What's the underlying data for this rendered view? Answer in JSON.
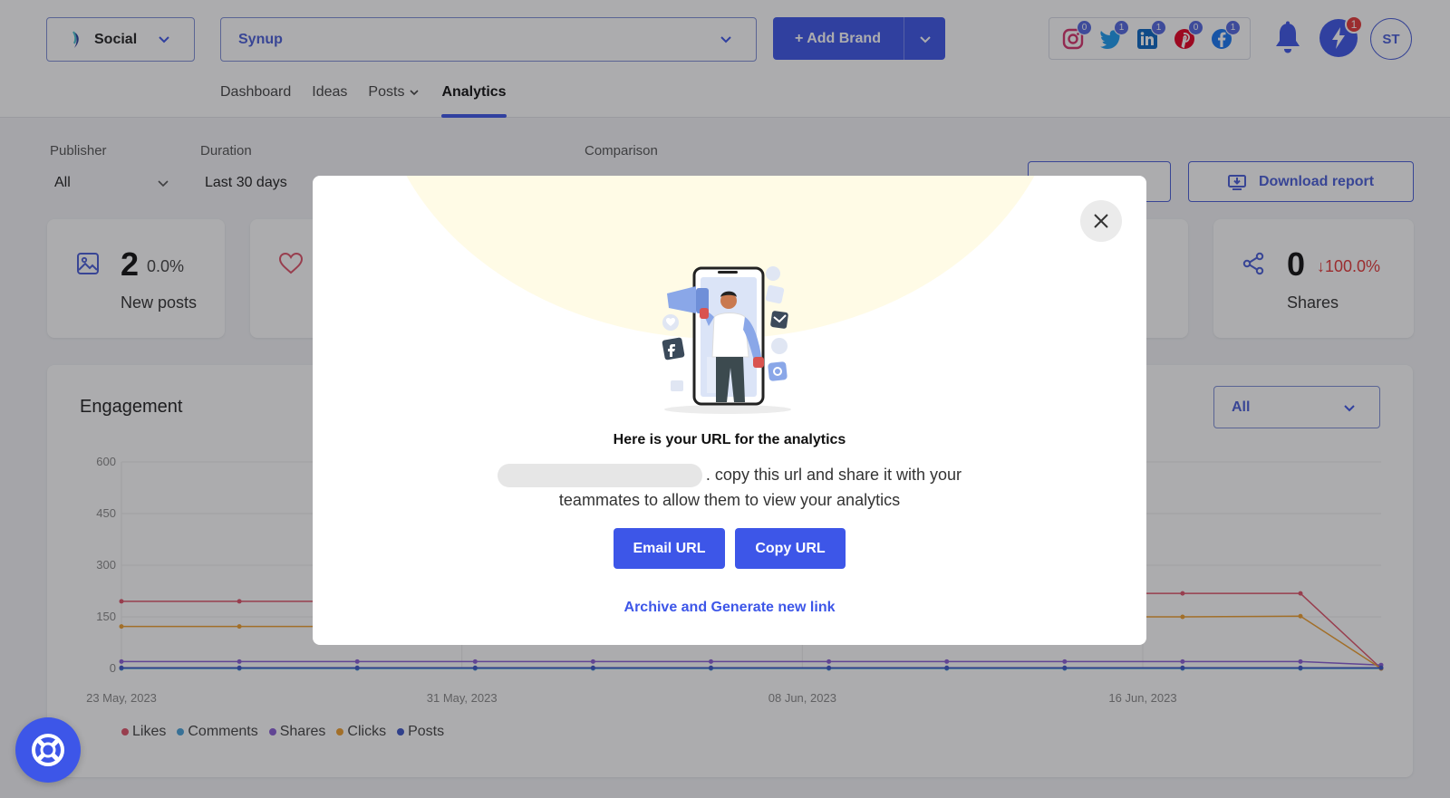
{
  "header": {
    "app_select": "Social",
    "brand_select": "Synup",
    "add_brand": "+ Add Brand",
    "social_badges": {
      "instagram": "0",
      "twitter": "1",
      "linkedin": "1",
      "pinterest": "0",
      "facebook": "1"
    },
    "notifications_badge": "1",
    "avatar_initials": "ST"
  },
  "nav": {
    "tabs": [
      "Dashboard",
      "Ideas",
      "Posts",
      "Analytics"
    ],
    "active": "Analytics"
  },
  "filters": {
    "publisher_label": "Publisher",
    "publisher_value": "All",
    "duration_label": "Duration",
    "duration_value": "Last 30 days",
    "comparison_label": "Comparison",
    "download_report": "Download report"
  },
  "stats": [
    {
      "value": "2",
      "change": "0.0%",
      "label": "New posts"
    },
    {
      "value": "0",
      "change": "↓100.0%",
      "label": "Shares"
    }
  ],
  "stats_partial_pct": "%",
  "engagement": {
    "title": "Engagement",
    "filter_value": "All"
  },
  "chart_data": {
    "type": "line",
    "x_tick_labels": [
      "23 May, 2023",
      "31 May, 2023",
      "08 Jun, 2023",
      "16 Jun, 2023"
    ],
    "y_tick_labels": [
      "600",
      "450",
      "300",
      "150",
      "0"
    ],
    "ylim": [
      0,
      600
    ],
    "series": [
      {
        "name": "Likes",
        "color": "#e0546a",
        "visible_values": [
          195,
          195,
          195,
          195,
          195,
          218,
          218,
          218,
          218,
          218,
          218,
          0
        ]
      },
      {
        "name": "Comments",
        "color": "#4aa3d9",
        "visible_values": [
          0,
          0,
          0,
          0,
          0,
          0,
          0,
          0,
          0,
          0,
          0,
          0
        ]
      },
      {
        "name": "Shares",
        "color": "#8a5ed6",
        "visible_values": [
          20,
          20,
          20,
          20,
          20,
          20,
          20,
          20,
          20,
          20,
          20,
          10
        ]
      },
      {
        "name": "Clicks",
        "color": "#f0a030",
        "visible_values": [
          122,
          122,
          122,
          122,
          122,
          150,
          150,
          150,
          150,
          150,
          152,
          0
        ]
      },
      {
        "name": "Posts",
        "color": "#3d56c8",
        "visible_values": [
          2,
          2,
          2,
          2,
          2,
          2,
          2,
          2,
          2,
          2,
          2,
          2
        ]
      }
    ],
    "legend_position": "bottom-left",
    "grid": true
  },
  "modal": {
    "heading": "Here is your URL for the analytics",
    "message_part1": ". copy this url and share it with your",
    "message_part2": "teammates to allow them to view your analytics",
    "email_btn": "Email URL",
    "copy_btn": "Copy URL",
    "archive_link": "Archive and Generate new link"
  },
  "colors": {
    "primary": "#3d56e8",
    "accent_border": "#7f8fd6",
    "negative": "#e53939"
  }
}
